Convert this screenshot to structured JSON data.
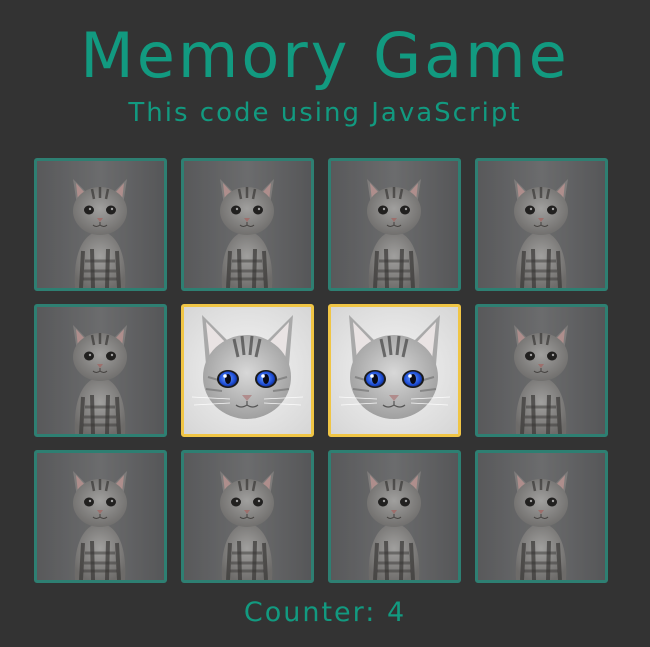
{
  "header": {
    "title": "Memory Game",
    "subtitle": "This code using JavaScript"
  },
  "board": {
    "rows": 3,
    "columns": 4,
    "cards": [
      {
        "row": 1,
        "col": 1,
        "state": "hidden",
        "image": "kitten-sitting-image"
      },
      {
        "row": 1,
        "col": 2,
        "state": "hidden",
        "image": "kitten-sitting-image"
      },
      {
        "row": 1,
        "col": 3,
        "state": "hidden",
        "image": "kitten-sitting-image"
      },
      {
        "row": 1,
        "col": 4,
        "state": "hidden",
        "image": "kitten-sitting-image"
      },
      {
        "row": 2,
        "col": 1,
        "state": "hidden",
        "image": "kitten-sitting-image"
      },
      {
        "row": 2,
        "col": 2,
        "state": "revealed",
        "image": "blue-eyed-cat-image"
      },
      {
        "row": 2,
        "col": 3,
        "state": "revealed",
        "image": "blue-eyed-cat-image"
      },
      {
        "row": 2,
        "col": 4,
        "state": "hidden",
        "image": "kitten-sitting-image"
      },
      {
        "row": 3,
        "col": 1,
        "state": "hidden",
        "image": "kitten-sitting-image"
      },
      {
        "row": 3,
        "col": 2,
        "state": "hidden",
        "image": "kitten-sitting-image"
      },
      {
        "row": 3,
        "col": 3,
        "state": "hidden",
        "image": "kitten-sitting-image"
      },
      {
        "row": 3,
        "col": 4,
        "state": "hidden",
        "image": "kitten-sitting-image"
      }
    ]
  },
  "footer": {
    "counter_label": "Counter:",
    "counter_value": "4"
  },
  "colors": {
    "background": "#333333",
    "accent": "#129a80",
    "card_border": "#2e7f72",
    "selected_border": "#f0c545"
  }
}
